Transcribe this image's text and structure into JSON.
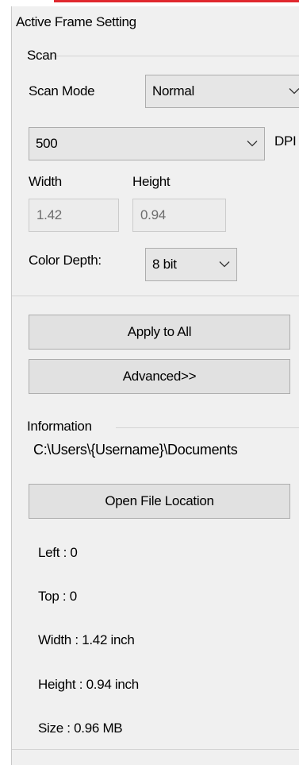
{
  "panel": {
    "title": "Active Frame Setting"
  },
  "scan": {
    "group_label": "Scan",
    "scan_mode_label": "Scan Mode",
    "scan_mode_value": "Normal",
    "dpi_value": "500",
    "dpi_label": "DPI",
    "width_label": "Width",
    "height_label": "Height",
    "width_value": "1.42",
    "height_value": "0.94",
    "color_depth_label": "Color Depth:",
    "color_depth_value": "8 bit"
  },
  "buttons": {
    "apply_all": "Apply to All",
    "advanced": "Advanced>>",
    "open_location": "Open File Location"
  },
  "information": {
    "group_label": "Information",
    "path": "C:\\Users\\{Username}\\Documents",
    "left": "Left : 0",
    "top": "Top : 0",
    "width": "Width : 1.42 inch",
    "height": "Height : 0.94 inch",
    "size": "Size : 0.96 MB"
  },
  "icons": {
    "dropdown": "chevron-down-icon"
  }
}
